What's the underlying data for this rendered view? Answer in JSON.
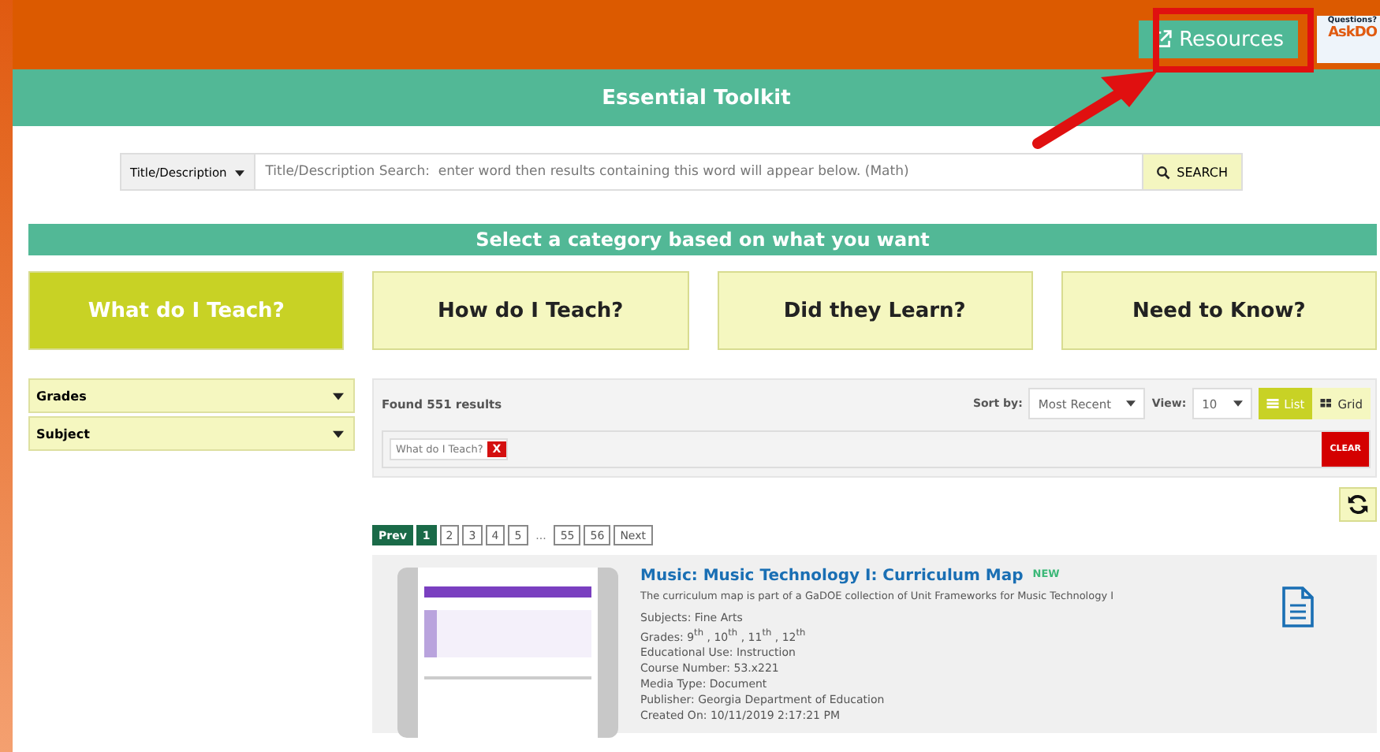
{
  "header": {
    "resources_button": "Resources",
    "askdoe_logo": {
      "tagline": "Questions?",
      "name": "AskDO"
    }
  },
  "title": "Essential Toolkit",
  "search": {
    "scope": "Title/Description",
    "placeholder": "Title/Description Search:  enter word then results containing this word will appear below. (Math)",
    "button": "SEARCH"
  },
  "category_heading": "Select a category based on what you want",
  "categories": [
    {
      "label": "What do I Teach?",
      "selected": true
    },
    {
      "label": "How do I Teach?",
      "selected": false
    },
    {
      "label": "Did they Learn?",
      "selected": false
    },
    {
      "label": "Need to Know?",
      "selected": false
    }
  ],
  "filters": [
    {
      "label": "Grades"
    },
    {
      "label": "Subject"
    }
  ],
  "results": {
    "count": "Found 551 results",
    "sort_label": "Sort by:",
    "sort_value": "Most Recent",
    "view_label": "View:",
    "view_value": "10",
    "view_modes": [
      {
        "label": "List",
        "selected": true
      },
      {
        "label": "Grid",
        "selected": false
      }
    ],
    "active_tags": [
      {
        "label": "What do I Teach?",
        "remove": "X"
      }
    ],
    "clear": "CLEAR"
  },
  "pagination": {
    "prev": "Prev",
    "next": "Next",
    "pages": [
      {
        "label": "1",
        "selected": true
      },
      {
        "label": "2",
        "selected": false
      },
      {
        "label": "3",
        "selected": false
      },
      {
        "label": "4",
        "selected": false
      },
      {
        "label": "5",
        "selected": false
      },
      {
        "label": "...",
        "kind": "gap"
      },
      {
        "label": "55",
        "selected": false
      },
      {
        "label": "56",
        "selected": false
      }
    ]
  },
  "items": [
    {
      "title": "Music: Music Technology I: Curriculum Map",
      "badge": "NEW",
      "description": "The curriculum map is part of a GaDOE collection of Unit Frameworks for Music Technology I",
      "details": [
        "Subjects: Fine Arts",
        "Grades: 9$^{th}$ , 10$^{th}$ , 11$^{th}$ , 12$^{th}$",
        "Educational Use: Instruction",
        "Course Number: 53.x221",
        "Media Type: Document",
        "Publisher: Georgia Department of Education",
        "Created On: 10/11/2019 2:17:21 PM"
      ]
    }
  ]
}
